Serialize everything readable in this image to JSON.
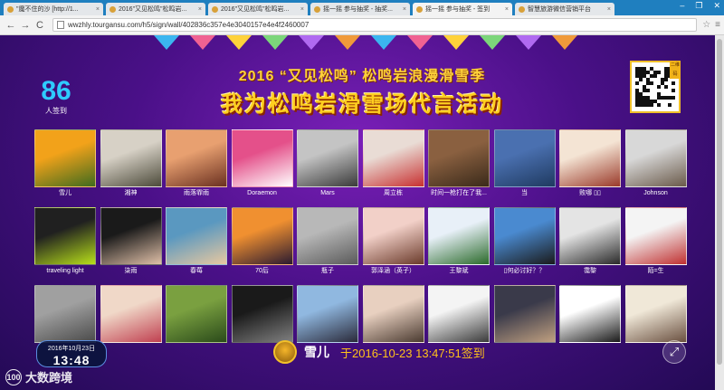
{
  "browser": {
    "tabs": [
      {
        "title": "\"魔不住的沙 [http://1...",
        "active": false
      },
      {
        "title": "2016\"又见松鸣\"松鸣岩...",
        "active": false
      },
      {
        "title": "2016\"又见松鸣\"松鸣岩...",
        "active": false
      },
      {
        "title": "摇一摇 参与抽奖 - 抽奖...",
        "active": false
      },
      {
        "title": "摇一摇 参与抽奖 - 签到",
        "active": true
      },
      {
        "title": "智慧旅游微信营销平台",
        "active": false
      }
    ],
    "url": "wwzhly.tourgansu.com/h5/sign/wall/402836c357e4e3040157e4e4f2460007",
    "nav": {
      "back": "←",
      "forward": "→",
      "reload": "C"
    },
    "window_controls": [
      "–",
      "❐",
      "✕"
    ]
  },
  "header": {
    "count": "86",
    "count_label": "人签到",
    "title_line1": "2016 “又见松鸣” 松鸣岩浪漫滑雪季",
    "title_line2": "我为松鸣岩滑雪场代言活动",
    "qr_tag": "二维码"
  },
  "participants": [
    {
      "name": "雪儿",
      "c1": "#f2a21a",
      "c2": "#3f6b1e"
    },
    {
      "name": "湘神",
      "c1": "#d7d1c6",
      "c2": "#4c4a3a"
    },
    {
      "name": "雨落霏雨",
      "c1": "#e8a070",
      "c2": "#6a3020"
    },
    {
      "name": "Doraemon",
      "c1": "#e4508a",
      "c2": "#ffffff"
    },
    {
      "name": "Mars",
      "c1": "#c4c4c4",
      "c2": "#3a3a3a"
    },
    {
      "name": "周立栋",
      "c1": "#e9dcd5",
      "c2": "#c83030"
    },
    {
      "name": "时间一枪打在了我...",
      "c1": "#8a6040",
      "c2": "#3a2a1a"
    },
    {
      "name": "当",
      "c1": "#4a70b0",
      "c2": "#1f3a60"
    },
    {
      "name": "败哪 ▯▯",
      "c1": "#f4e4d4",
      "c2": "#9a3a2a"
    },
    {
      "name": "Johnson",
      "c1": "#d8d8d8",
      "c2": "#6a5a4a"
    },
    {
      "name": "traveling light",
      "c1": "#202020",
      "c2": "#b8e01a"
    },
    {
      "name": "柒雨",
      "c1": "#1a1a1a",
      "c2": "#e0c0a8"
    },
    {
      "name": "春莓",
      "c1": "#5a98c0",
      "c2": "#e8c8a0"
    },
    {
      "name": "70后",
      "c1": "#f09030",
      "c2": "#2a1a30"
    },
    {
      "name": "瓶子",
      "c1": "#b8b8b8",
      "c2": "#5a5a5a"
    },
    {
      "name": "郭泽涵（英子）",
      "c1": "#f2d0c8",
      "c2": "#6a3a2a"
    },
    {
      "name": "王黎斌",
      "c1": "#e8f0f8",
      "c2": "#2a6a2a"
    },
    {
      "name": "▯何必讨好？？",
      "c1": "#4a8ad0",
      "c2": "#1a1a1a"
    },
    {
      "name": "霭黎",
      "c1": "#e4e4e4",
      "c2": "#2a2a2a"
    },
    {
      "name": "陌=生",
      "c1": "#f4f4f4",
      "c2": "#c03030"
    },
    {
      "name": "",
      "c1": "#a0a0a0",
      "c2": "#4a4a4a"
    },
    {
      "name": "",
      "c1": "#f0d8c8",
      "c2": "#c04050"
    },
    {
      "name": "",
      "c1": "#7aa040",
      "c2": "#2a4a1a"
    },
    {
      "name": "",
      "c1": "#1a1a1a",
      "c2": "#808080"
    },
    {
      "name": "",
      "c1": "#90b8e0",
      "c2": "#2a2a3a"
    },
    {
      "name": "",
      "c1": "#e8d0c0",
      "c2": "#4a3a30"
    },
    {
      "name": "",
      "c1": "#f4f4f4",
      "c2": "#3a3a3a"
    },
    {
      "name": "",
      "c1": "#3a3a4a",
      "c2": "#c0a080"
    },
    {
      "name": "",
      "c1": "#ffffff",
      "c2": "#1a1a1a"
    },
    {
      "name": "",
      "c1": "#f0e8d8",
      "c2": "#6a5040"
    }
  ],
  "clock": {
    "date": "2016年10月23日",
    "time": "13:48"
  },
  "logo": {
    "mark": "100",
    "text": "大数跨境"
  },
  "latest_checkin": {
    "name": "雪儿",
    "message": "于2016-10-23 13:47:51签到"
  },
  "fullscreen_icon": "⤢"
}
